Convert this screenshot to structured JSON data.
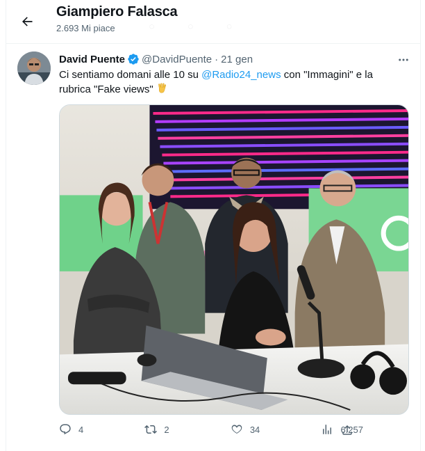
{
  "header": {
    "title": "Giampiero Falasca",
    "subtitle": "2.693 Mi piace"
  },
  "tweet": {
    "author_name": "David Puente",
    "handle": "@DavidPuente",
    "separator": "·",
    "time": "21 gen",
    "text_before": "Ci sentiamo domani alle 10 su ",
    "mention": "@Radio24_news",
    "text_after": " con \"Immagini\" e la rubrica \"Fake views\" ",
    "emoji": "vulcan-salute-emoji"
  },
  "actions": {
    "replies": "4",
    "retweets": "2",
    "likes": "34",
    "views": "6.257"
  },
  "colors": {
    "link": "#1d9bf0",
    "verified": "#1d9bf0",
    "secondary_text": "#536471"
  }
}
